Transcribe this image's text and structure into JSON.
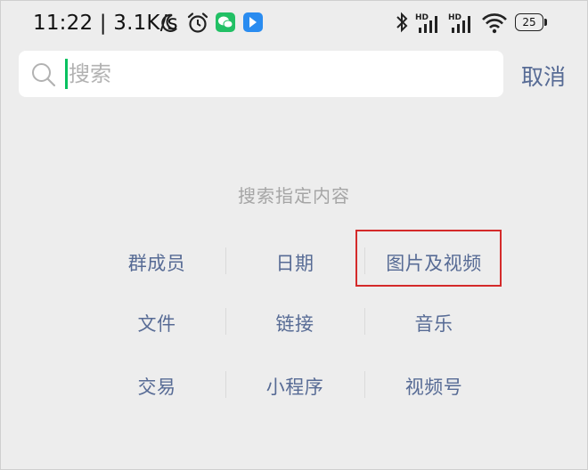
{
  "status_bar": {
    "time": "11:22 | 3.1K/s",
    "battery": "25",
    "signal_label_1": "HD",
    "signal_label_2": "HD",
    "icons": [
      "moon-icon",
      "alarm-clock-icon",
      "wechat-icon",
      "app-icon",
      "bluetooth-icon",
      "signal-icon",
      "signal-icon",
      "wifi-icon",
      "battery-icon"
    ]
  },
  "search": {
    "placeholder": "搜索",
    "value": "",
    "cancel_label": "取消"
  },
  "section": {
    "title": "搜索指定内容",
    "items": [
      [
        "群成员",
        "日期",
        "图片及视频"
      ],
      [
        "文件",
        "链接",
        "音乐"
      ],
      [
        "交易",
        "小程序",
        "视频号"
      ]
    ]
  },
  "colors": {
    "accent_link": "#576b95",
    "cursor": "#07c160",
    "highlight": "#d42a2a",
    "background": "#ededed"
  }
}
